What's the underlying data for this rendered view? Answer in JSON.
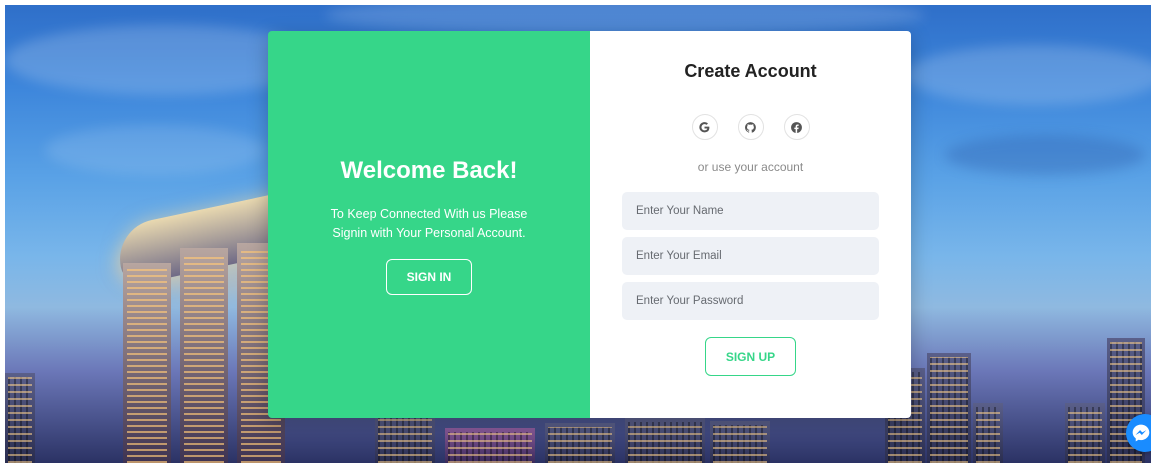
{
  "welcome": {
    "title": "Welcome Back!",
    "message": "To Keep Connected With us Please Signin with Your Personal Account.",
    "signin_label": "SIGN IN"
  },
  "signup": {
    "title": "Create Account",
    "social_icons": [
      "google-icon",
      "github-icon",
      "facebook-icon"
    ],
    "divider_text": "or use your account",
    "name_placeholder": "Enter Your Name",
    "email_placeholder": "Enter Your Email",
    "password_placeholder": "Enter Your Password",
    "signup_label": "SIGN UP"
  },
  "colors": {
    "accent": "#36d689",
    "input_bg": "#eef1f6",
    "chat_button": "#1a8cff"
  },
  "chat_widget": {
    "icon": "messenger-icon"
  }
}
